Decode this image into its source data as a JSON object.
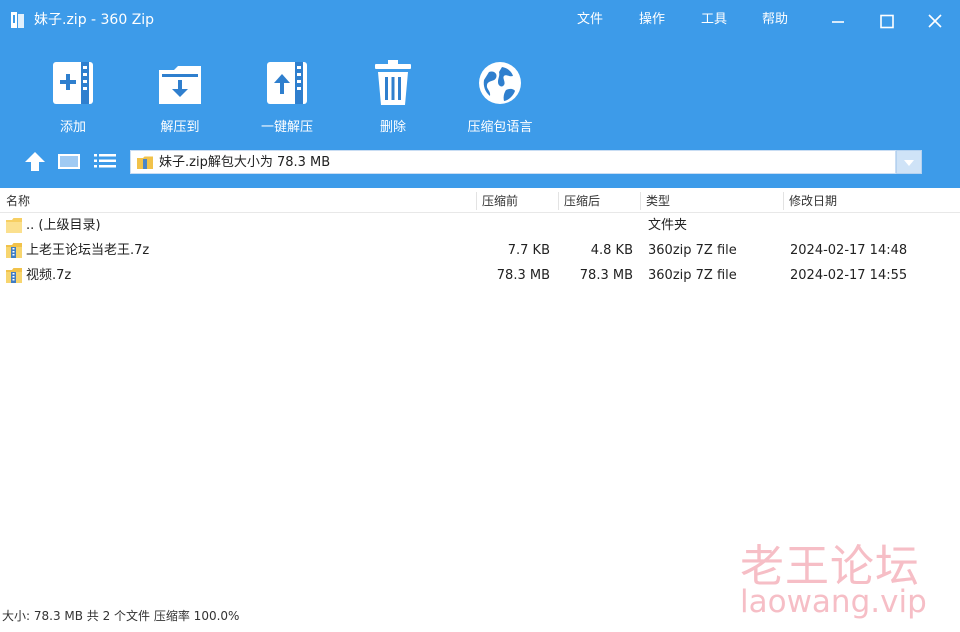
{
  "window": {
    "title": "妹子.zip - 360 Zip"
  },
  "menu": [
    "文件",
    "操作",
    "工具",
    "帮助"
  ],
  "toolbar": [
    {
      "label": "添加",
      "icon": "add-archive-icon"
    },
    {
      "label": "解压到",
      "icon": "extract-to-icon"
    },
    {
      "label": "一键解压",
      "icon": "one-click-extract-icon"
    },
    {
      "label": "删除",
      "icon": "trash-icon"
    },
    {
      "label": "压缩包语言",
      "icon": "globe-icon"
    }
  ],
  "address": {
    "path": "妹子.zip解包大小为 78.3 MB"
  },
  "columns": [
    "名称",
    "压缩前",
    "压缩后",
    "类型",
    "修改日期"
  ],
  "files": [
    {
      "name": ".. (上级目录)",
      "before": "",
      "after": "",
      "type": "文件夹",
      "date": "",
      "icon": "folder-icon"
    },
    {
      "name": "上老王论坛当老王.7z",
      "before": "7.7 KB",
      "after": "4.8 KB",
      "type": "360zip 7Z file",
      "date": "2024-02-17 14:48",
      "icon": "archive-file-icon"
    },
    {
      "name": "视频.7z",
      "before": "78.3 MB",
      "after": "78.3 MB",
      "type": "360zip 7Z file",
      "date": "2024-02-17 14:55",
      "icon": "archive-file-icon"
    }
  ],
  "status": "大小: 78.3 MB 共 2 个文件 压缩率 100.0%",
  "watermark": {
    "cn": "老王论坛",
    "en": "laowang.vip"
  },
  "colors": {
    "header": "#3d9be9",
    "watermark": "#f6bec6"
  }
}
